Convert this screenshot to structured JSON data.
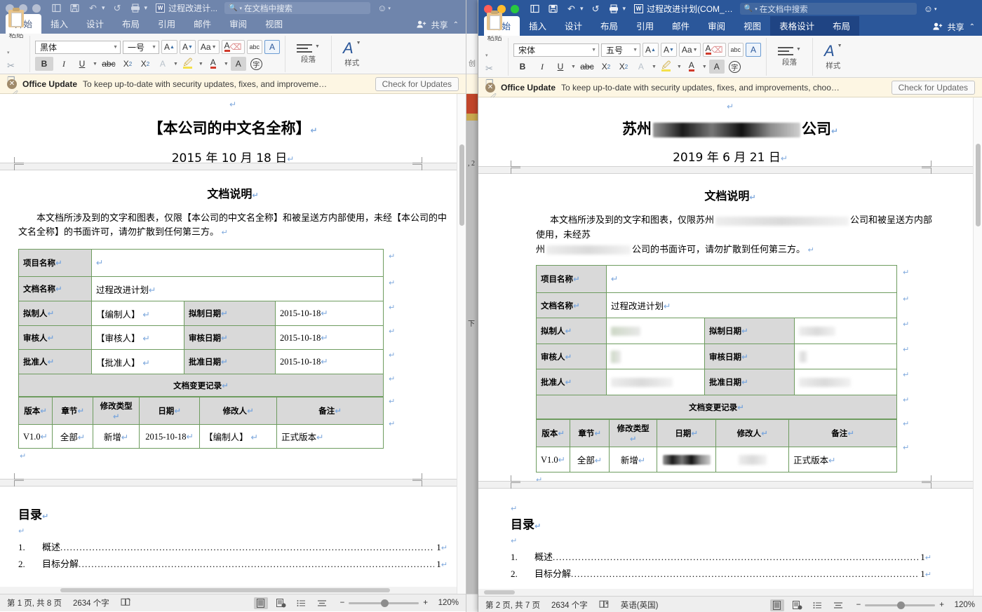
{
  "windows": {
    "left": {
      "title": "过程改进计...",
      "active": false,
      "search_placeholder": "在文档中搜索",
      "share_label": "共享",
      "tabs": [
        {
          "label": "开始",
          "active": true
        },
        {
          "label": "插入",
          "active": false
        },
        {
          "label": "设计",
          "active": false
        },
        {
          "label": "布局",
          "active": false
        },
        {
          "label": "引用",
          "active": false
        },
        {
          "label": "邮件",
          "active": false
        },
        {
          "label": "审阅",
          "active": false
        },
        {
          "label": "视图",
          "active": false
        }
      ],
      "ribbon": {
        "paste_label": "粘贴",
        "font_name": "黑体",
        "font_size": "一号",
        "paragraph_label": "段落",
        "styles_label": "样式",
        "bold": "B",
        "italic": "I",
        "underline": "U",
        "strike": "abc",
        "subscript": "X",
        "superscript": "X",
        "grow_font": "A",
        "shrink_font": "A",
        "change_case": "Aa",
        "clear_format": "A",
        "text_effects": "A",
        "highlight": "A",
        "font_color": "A",
        "shading": "A",
        "char_border": "字",
        "spell_abc": "abc",
        "text_box_a": "A",
        "bold_on": true
      },
      "banner": {
        "title": "Office Update",
        "message": "To keep up-to-date with security updates, fixes, and improveme…",
        "button": "Check for Updates"
      },
      "document": {
        "company_title": "【本公司的中文名全称】",
        "date_line": "2015 年 10 月 18 日",
        "section_heading": "文档说明",
        "disclaimer": "本文档所涉及到的文字和图表，仅限【本公司的中文名全称】和被呈送方内部使用，未经【本公司的中文名全称】的书面许可，请勿扩散到任何第三方。",
        "info_table": {
          "project_name_label": "项目名称",
          "project_name_value": "",
          "doc_name_label": "文档名称",
          "doc_name_value": "过程改进计划",
          "author_label": "拟制人",
          "author_value": "【编制人】",
          "author_date_label": "拟制日期",
          "author_date_value": "2015-10-18",
          "reviewer_label": "审核人",
          "reviewer_value": "【审核人】",
          "review_date_label": "审核日期",
          "review_date_value": "2015-10-18",
          "approver_label": "批准人",
          "approver_value": "【批准人】",
          "approve_date_label": "批准日期",
          "approve_date_value": "2015-10-18",
          "change_log_title": "文档变更记录",
          "change_headers": [
            "版本",
            "章节",
            "修改类型",
            "日期",
            "修改人",
            "备注"
          ],
          "change_rows": [
            [
              "V1.0",
              "全部",
              "新增",
              "2015-10-18",
              "【编制人】",
              "正式版本"
            ]
          ]
        },
        "toc_heading": "目录",
        "toc_entries": [
          {
            "num": "1.",
            "text": "概述",
            "page": "1"
          },
          {
            "num": "2.",
            "text": "目标分解",
            "page": "1"
          }
        ]
      },
      "status": {
        "page_info": "第 1 页, 共 8 页",
        "word_count": "2634 个字",
        "language": "",
        "zoom": "120%"
      }
    },
    "right": {
      "title": "过程改进计划(COM_…",
      "active": true,
      "search_placeholder": "在文档中搜索",
      "share_label": "共享",
      "tabs": [
        {
          "label": "开始",
          "active": true
        },
        {
          "label": "插入",
          "active": false
        },
        {
          "label": "设计",
          "active": false
        },
        {
          "label": "布局",
          "active": false
        },
        {
          "label": "引用",
          "active": false
        },
        {
          "label": "邮件",
          "active": false
        },
        {
          "label": "审阅",
          "active": false
        },
        {
          "label": "视图",
          "active": false
        },
        {
          "label": "表格设计",
          "active": false,
          "contextual": true
        },
        {
          "label": "布局",
          "active": false,
          "contextual": true
        }
      ],
      "ribbon": {
        "paste_label": "粘贴",
        "font_name": "宋体",
        "font_size": "五号",
        "paragraph_label": "段落",
        "styles_label": "样式",
        "bold": "B",
        "italic": "I",
        "underline": "U",
        "strike": "abc",
        "subscript": "X",
        "superscript": "X",
        "grow_font": "A",
        "shrink_font": "A",
        "change_case": "Aa",
        "clear_format": "A",
        "text_effects": "A",
        "highlight": "A",
        "font_color": "A",
        "shading": "A",
        "char_border": "字",
        "spell_abc": "abc",
        "text_box_a": "A",
        "bold_on": false
      },
      "banner": {
        "title": "Office Update",
        "message": "To keep up-to-date with security updates, fixes, and improvements, choo…",
        "button": "Check for Updates"
      },
      "document": {
        "company_title_prefix": "苏州",
        "company_title_suffix": "公司",
        "date_line": "2019 年 6 月 21 日",
        "section_heading": "文档说明",
        "disclaimer_part1": "本文档所涉及到的文字和图表，仅限苏州",
        "disclaimer_part2": "公司和被呈送方内部使用，未经苏",
        "disclaimer_part3": "州",
        "disclaimer_part4": "公司的书面许可，请勿扩散到任何第三方。",
        "info_table": {
          "project_name_label": "项目名称",
          "project_name_value": "",
          "doc_name_label": "文档名称",
          "doc_name_value": "过程改进计划",
          "author_label": "拟制人",
          "author_value": "",
          "author_date_label": "拟制日期",
          "author_date_value": "",
          "reviewer_label": "审核人",
          "reviewer_value": "",
          "review_date_label": "审核日期",
          "review_date_value": "",
          "approver_label": "批准人",
          "approver_value": "",
          "approve_date_label": "批准日期",
          "approve_date_value": "",
          "change_log_title": "文档变更记录",
          "change_headers": [
            "版本",
            "章节",
            "修改类型",
            "日期",
            "修改人",
            "备注"
          ],
          "change_rows": [
            [
              "V1.0",
              "全部",
              "新增",
              "",
              "",
              "正式版本"
            ]
          ]
        },
        "toc_heading": "目录",
        "toc_entries": [
          {
            "num": "1.",
            "text": "概述",
            "page": "1"
          },
          {
            "num": "2.",
            "text": "目标分解",
            "page": "1"
          }
        ]
      },
      "status": {
        "page_info": "第 2 页, 共 7 页",
        "word_count": "2634 个字",
        "language": "英语(英国)",
        "zoom": "120%"
      }
    }
  },
  "icons": {
    "sidebar": "◧",
    "save": "💾",
    "undo": "↶",
    "redo": "↺",
    "print": "🖶",
    "more": "▾",
    "search": "⌕",
    "smiley": "☺",
    "share_person": "👤",
    "collapse_ribbon": "⌃",
    "close_banner": "✕",
    "read_mode": "▤",
    "print_layout": "▤",
    "web_layout": "⠿",
    "outline": "≡",
    "zoom_out": "−",
    "zoom_in": "+",
    "focus": "⌸"
  },
  "colors": {
    "title_active": "#2b579a",
    "title_inactive": "#6f85ac",
    "banner_bg": "#fdf6e3",
    "table_border": "#6e9c5f",
    "table_label_bg": "#d9d9d9",
    "pilcrow": "#7fa9dd"
  }
}
